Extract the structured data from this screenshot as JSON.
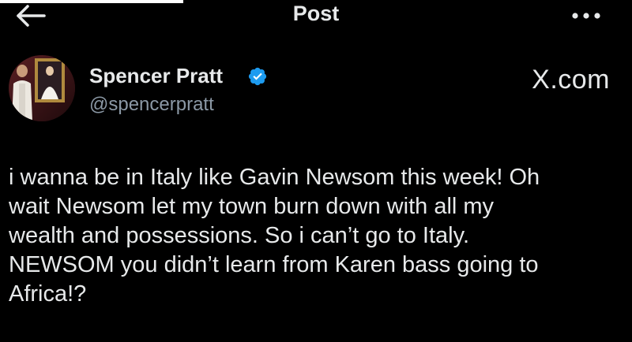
{
  "header": {
    "title": "Post",
    "back_icon": "arrow-left-icon",
    "more_icon": "more-horizontal-icon"
  },
  "author": {
    "name": "Spencer Pratt",
    "handle": "@spencerpratt",
    "verified_icon": "verified-badge-icon",
    "verified_color": "#1d9bf0"
  },
  "watermark": "X.com",
  "post": {
    "lines": [
      "i wanna be in Italy like Gavin Newsom this week! Oh",
      "wait Newsom let my town burn down with all my",
      "wealth and possessions.  So i can’t go to Italy.",
      "NEWSOM you didn’t learn from Karen bass going to",
      "Africa!?"
    ]
  }
}
